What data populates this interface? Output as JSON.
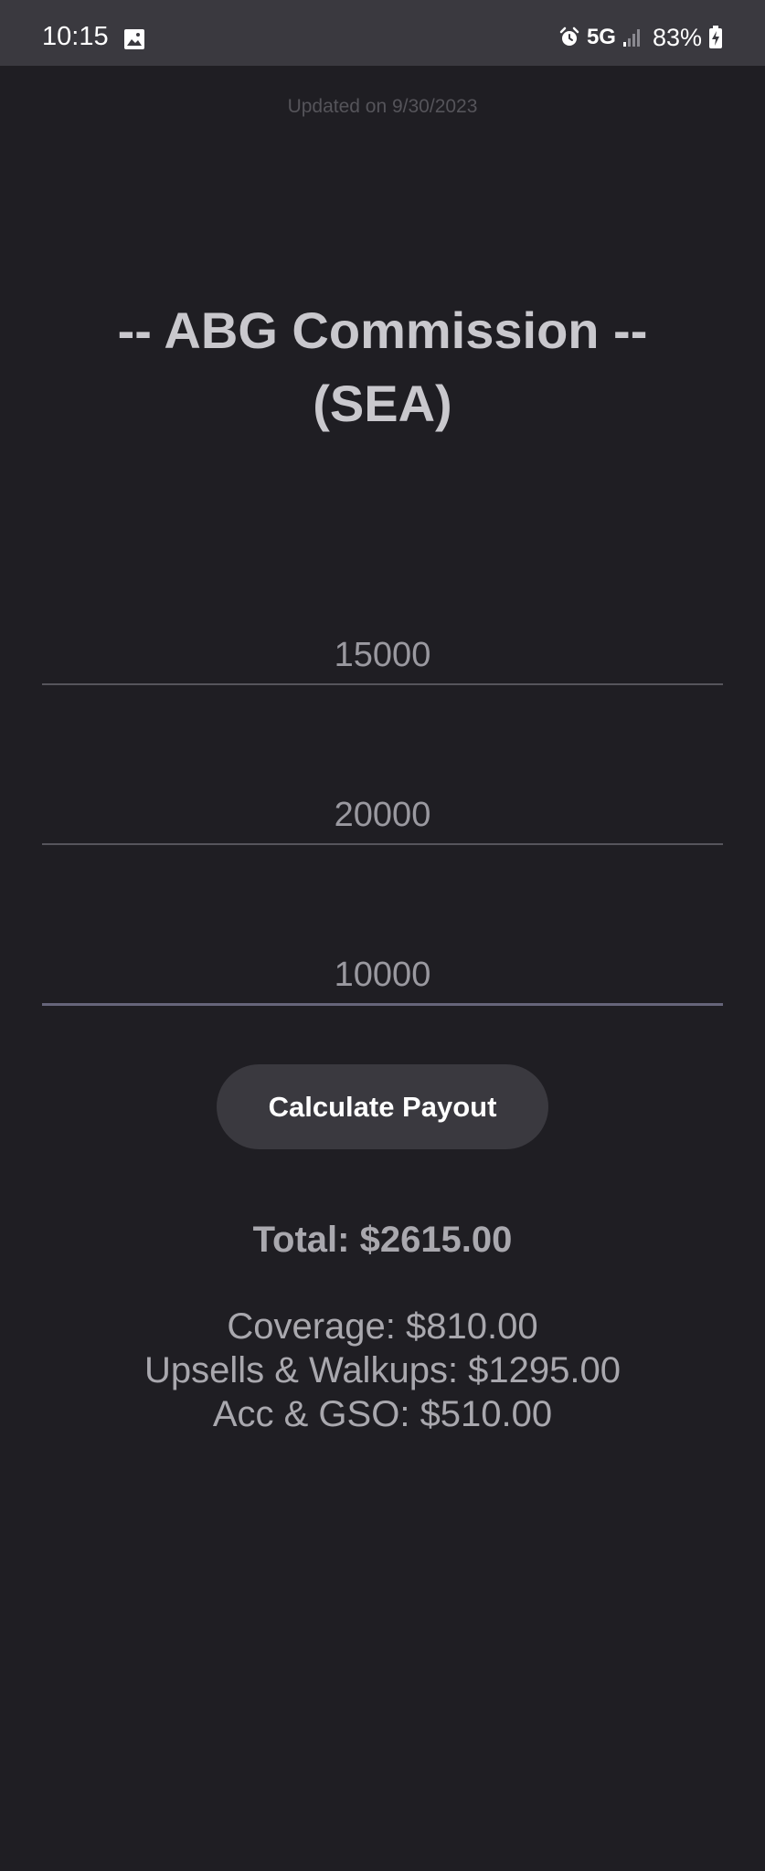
{
  "status_bar": {
    "time": "10:15",
    "network": "5G",
    "battery": "83%",
    "icons": [
      "image-icon",
      "alarm-icon",
      "signal-icon",
      "battery-charging-icon"
    ]
  },
  "header": {
    "updated": "Updated on 9/30/2023"
  },
  "title": "-- ABG Commission -- (SEA)",
  "inputs": [
    {
      "value": "15000"
    },
    {
      "value": "20000"
    },
    {
      "value": "10000"
    }
  ],
  "button": {
    "label": "Calculate Payout"
  },
  "results": {
    "total": "Total: $2615.00",
    "coverage": "Coverage: $810.00",
    "upsells": "Upsells & Walkups: $1295.00",
    "accessories": "Acc & GSO: $510.00"
  },
  "colors": {
    "background": "#1f1e23",
    "status_bar": "#3a393f",
    "button": "#3a393f",
    "text": "#c9c8cd"
  }
}
